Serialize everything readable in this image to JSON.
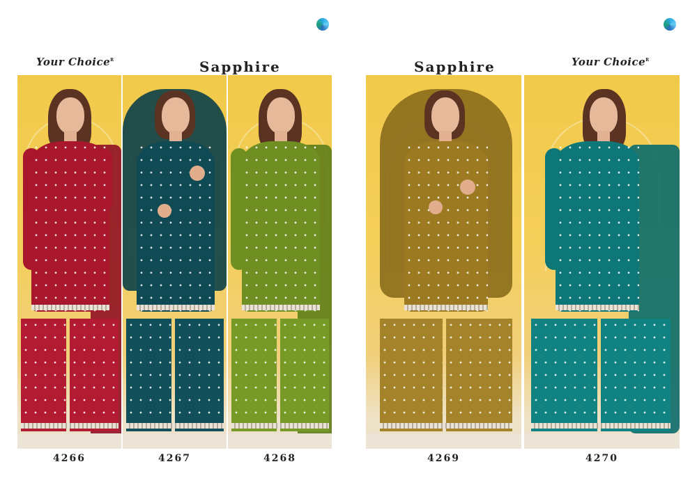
{
  "brand_left": "Your Choice",
  "brand_right": "Your Choice",
  "brand_mark": "R",
  "collection_left": "Sapphire",
  "collection_right": "Sapphire",
  "colors": {
    "c4266": "#a8172c",
    "c4267": "#0f4a55",
    "c4268": "#6f8f22",
    "c4269": "#9b7a22",
    "c4270": "#0e7878"
  },
  "codes": [
    "4266",
    "4267",
    "4268",
    "4269",
    "4270"
  ]
}
